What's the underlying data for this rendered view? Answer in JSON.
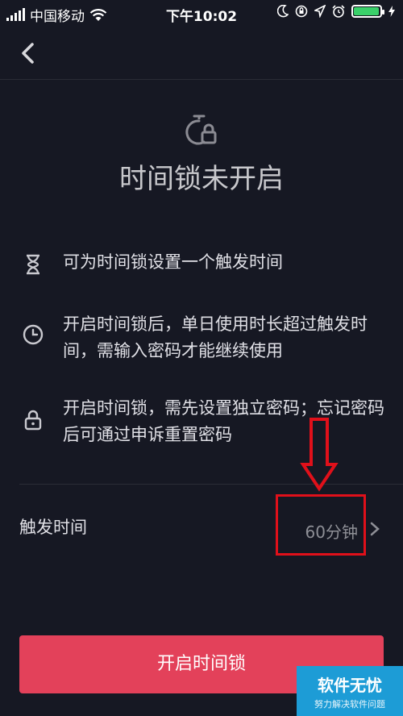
{
  "status_bar": {
    "carrier": "中国移动",
    "time": "下午10:02",
    "battery_level": 0.9,
    "colors": {
      "battery_fill": "#3ad06a"
    }
  },
  "header": {
    "back_icon": "chevron-left-icon"
  },
  "hero": {
    "icon": "timer-lock-icon",
    "title": "时间锁未开启"
  },
  "features": [
    {
      "icon": "hourglass-icon",
      "text": "可为时间锁设置一个触发时间"
    },
    {
      "icon": "clock-icon",
      "text": "开启时间锁后，单日使用时长超过触发时间，需输入密码才能继续使用"
    },
    {
      "icon": "lock-icon",
      "text": "开启时间锁，需先设置独立密码；忘记密码后可通过申诉重置密码"
    }
  ],
  "trigger_row": {
    "label": "触发时间",
    "value": "60分钟",
    "chevron_icon": "chevron-right-icon"
  },
  "primary_button": {
    "label": "开启时间锁",
    "color": "#e3415a"
  },
  "watermark": {
    "title": "软件无忧",
    "subtitle": "努力解决软件问题"
  },
  "annotation": {
    "color": "#e0101a"
  }
}
